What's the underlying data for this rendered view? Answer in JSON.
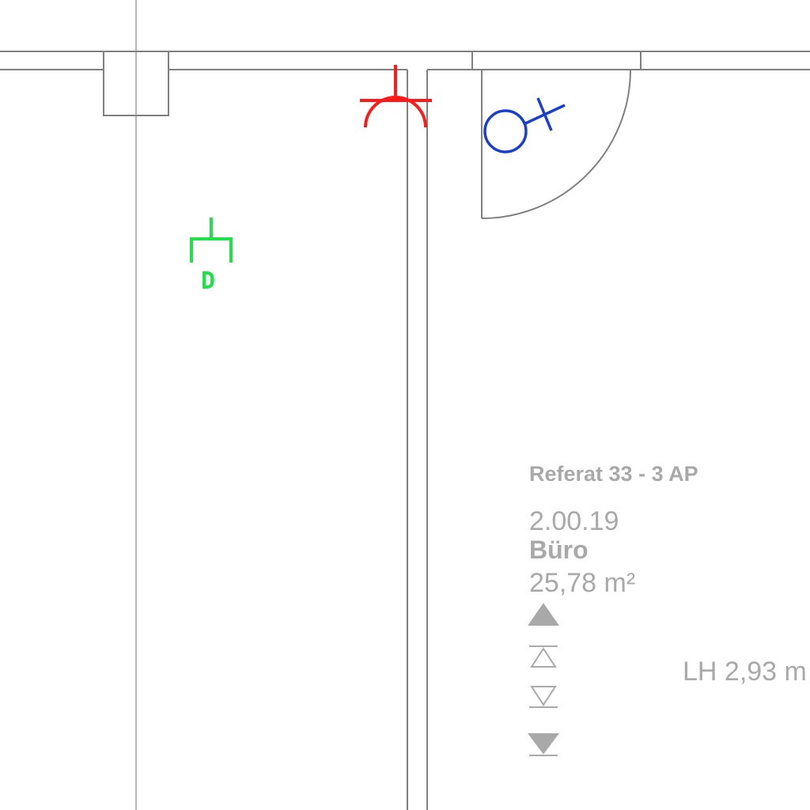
{
  "room": {
    "department": "Referat 33 -  3 AP",
    "number": "2.00.19",
    "type": "Büro",
    "area": "25,78 m²",
    "clear_height": "LH 2,93 m"
  },
  "symbols": {
    "data_outlet_label": "D",
    "data_outlet_color": "#22e04a",
    "phone_outlet_color": "#ff1a1a",
    "switch_color": "#1a3fd0"
  },
  "colors": {
    "wall": "#808080",
    "grid": "#b8b8b8",
    "text": "#a9a9a9",
    "level_marker": "#a9a9a9"
  }
}
